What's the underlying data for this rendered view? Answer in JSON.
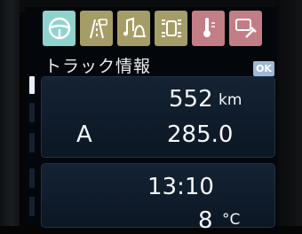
{
  "tabs": [
    {
      "name": "steering",
      "icon": "steering-wheel-icon",
      "state": "active"
    },
    {
      "name": "driver-assist",
      "icon": "road-camera-icon",
      "state": "inactive"
    },
    {
      "name": "audio-alerts",
      "icon": "music-bell-icon",
      "state": "inactive"
    },
    {
      "name": "vehicle",
      "icon": "vehicle-layout-icon",
      "state": "inactive"
    },
    {
      "name": "temperature",
      "icon": "thermometer-icon",
      "state": "inactive"
    },
    {
      "name": "maintenance",
      "icon": "wrench-icon",
      "state": "inactive"
    }
  ],
  "header": {
    "title": "トラック情報",
    "ok_label": "OK"
  },
  "trip_panel": {
    "distance": "552",
    "distance_unit": "km",
    "lane": "A",
    "odometer": "285.0"
  },
  "info_panel": {
    "time": "13:10",
    "temperature": "8",
    "temperature_unit": "°C"
  },
  "colors": {
    "active_tab": "#8fd3cf",
    "tab": "#a59d67",
    "alert_tab": "#c27d85",
    "panel": "#142233",
    "ok_badge": "#9fb8d6"
  }
}
